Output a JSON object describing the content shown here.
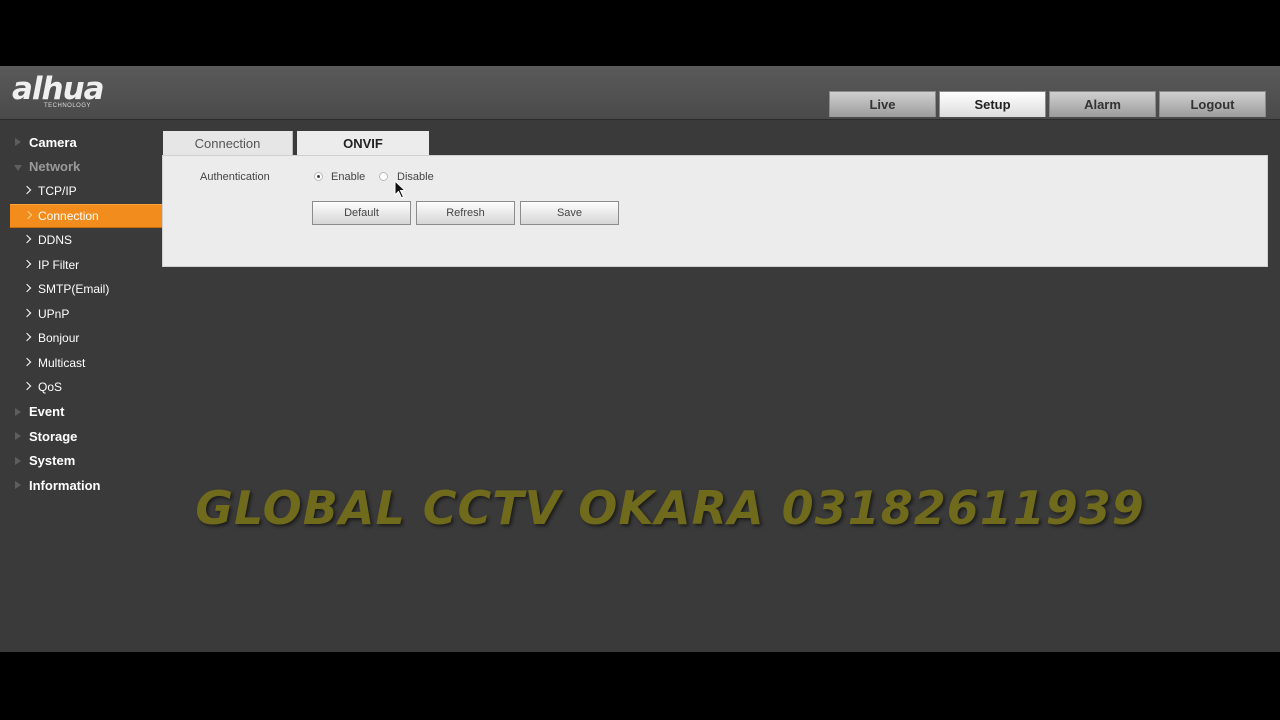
{
  "brand": {
    "logo": "alhua",
    "logo_sub": "TECHNOLOGY"
  },
  "nav_tabs": [
    {
      "label": "Live",
      "active": false
    },
    {
      "label": "Setup",
      "active": true
    },
    {
      "label": "Alarm",
      "active": false
    },
    {
      "label": "Logout",
      "active": false
    }
  ],
  "sidebar": {
    "items": [
      {
        "label": "Camera",
        "level": "top",
        "expanded": false
      },
      {
        "label": "Network",
        "level": "top",
        "expanded": true
      },
      {
        "label": "TCP/IP",
        "level": "sub"
      },
      {
        "label": "Connection",
        "level": "sub",
        "active": true
      },
      {
        "label": "DDNS",
        "level": "sub"
      },
      {
        "label": "IP Filter",
        "level": "sub"
      },
      {
        "label": "SMTP(Email)",
        "level": "sub"
      },
      {
        "label": "UPnP",
        "level": "sub"
      },
      {
        "label": "Bonjour",
        "level": "sub"
      },
      {
        "label": "Multicast",
        "level": "sub"
      },
      {
        "label": "QoS",
        "level": "sub"
      },
      {
        "label": "Event",
        "level": "top",
        "expanded": false
      },
      {
        "label": "Storage",
        "level": "top",
        "expanded": false
      },
      {
        "label": "System",
        "level": "top",
        "expanded": false
      },
      {
        "label": "Information",
        "level": "top",
        "expanded": false
      }
    ]
  },
  "content": {
    "tabs": [
      {
        "label": "Connection",
        "active": false
      },
      {
        "label": "ONVIF",
        "active": true
      }
    ],
    "authentication": {
      "label": "Authentication",
      "options": [
        "Enable",
        "Disable"
      ],
      "selected": "Enable"
    },
    "buttons": {
      "default": "Default",
      "refresh": "Refresh",
      "save": "Save"
    }
  },
  "watermark": "GLOBAL CCTV OKARA 03182611939",
  "colors": {
    "accent": "#f28c1c",
    "background": "#3a3a3a",
    "panel": "#ececec",
    "watermark": "#6f6a1c"
  },
  "icons": {
    "cursor": "mouse-pointer-icon",
    "expand": "triangle-right-icon",
    "sub": "chevron-right-icon"
  }
}
